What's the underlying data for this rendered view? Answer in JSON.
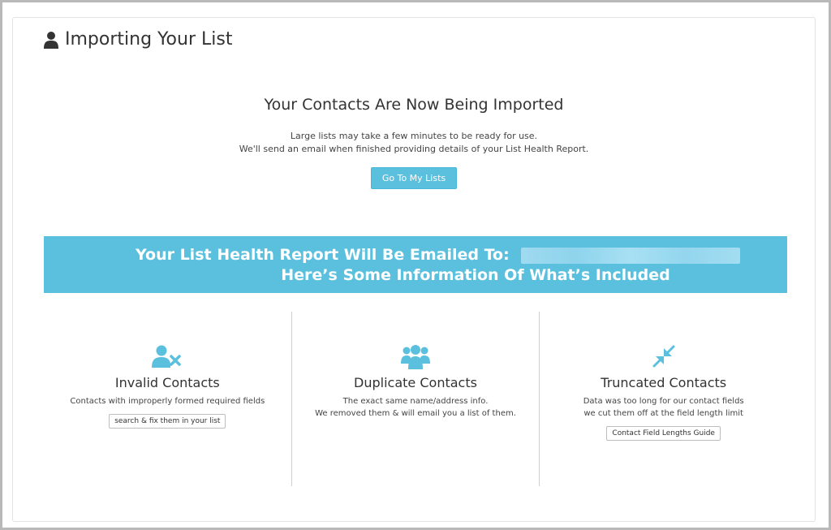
{
  "header": {
    "title": "Importing Your List",
    "icon": "user-icon"
  },
  "hero": {
    "title": "Your Contacts Are Now Being Imported",
    "line1": "Large lists may take a few minutes to be ready for use.",
    "line2": "We'll send an email when finished providing details of your List Health Report.",
    "button_label": "Go To My Lists"
  },
  "banner": {
    "line1": "Your List Health Report Will Be Emailed To:",
    "line2": "Here’s Some Information Of What’s Included"
  },
  "features": [
    {
      "icon": "user-remove-icon",
      "title": "Invalid Contacts",
      "desc1": "Contacts with improperly formed required fields",
      "desc2": "",
      "button_label": "search & fix them in your list"
    },
    {
      "icon": "users-group-icon",
      "title": "Duplicate Contacts",
      "desc1": "The exact same name/address info.",
      "desc2": "We removed them & will email you a list of them."
    },
    {
      "icon": "compress-arrows-icon",
      "title": "Truncated Contacts",
      "desc1": "Data was too long for our contact fields",
      "desc2": "we cut them off at the field length limit",
      "button_label": "Contact Field Lengths Guide"
    }
  ],
  "colors": {
    "accent": "#5bc0de",
    "text": "#333333",
    "icon": "#5bc0de"
  }
}
